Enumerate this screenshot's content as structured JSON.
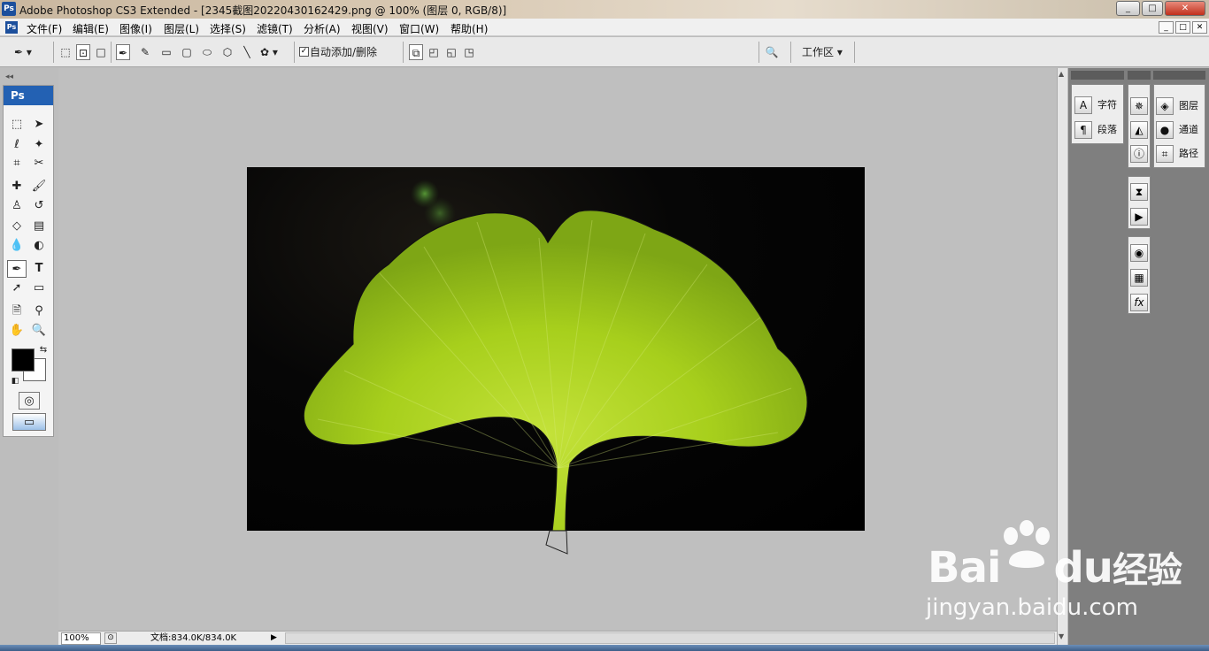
{
  "app": {
    "title": "Adobe Photoshop CS3 Extended - [2345截图20220430162429.png @ 100% (图层 0, RGB/8)]",
    "icon_label": "Ps"
  },
  "window_buttons": [
    "_",
    "□",
    "✕"
  ],
  "menu": {
    "items": [
      "文件(F)",
      "编辑(E)",
      "图像(I)",
      "图层(L)",
      "选择(S)",
      "滤镜(T)",
      "分析(A)",
      "视图(V)",
      "窗口(W)",
      "帮助(H)"
    ]
  },
  "options": {
    "auto_add_delete_label": "自动添加/删除",
    "auto_add_delete_checked": true,
    "workspace_label": "工作区"
  },
  "toolbox": {
    "header": "Ps",
    "tools": [
      "rect-marquee",
      "move",
      "lasso",
      "magic-wand",
      "crop",
      "slice",
      "healing",
      "brush",
      "stamp",
      "history-brush",
      "eraser",
      "gradient",
      "blur",
      "dodge",
      "pen",
      "type",
      "path-select",
      "shape",
      "notes",
      "eyedropper",
      "hand",
      "zoom"
    ]
  },
  "status": {
    "zoom": "100%",
    "doc_size": "文档:834.0K/834.0K"
  },
  "panels": {
    "col1": [
      {
        "icon": "A",
        "label": "字符"
      },
      {
        "icon": "¶",
        "label": "段落"
      }
    ],
    "col3": [
      {
        "icon": "◈",
        "label": "图层"
      },
      {
        "icon": "●",
        "label": "通道"
      },
      {
        "icon": "⌗",
        "label": "路径"
      }
    ]
  },
  "watermark": {
    "brand": "Bai",
    "brand2": "du",
    "suffix": "经验",
    "url": "jingyan.baidu.com"
  },
  "colors": {
    "accent": "#2361b3",
    "leaf": "#a7cf1c",
    "leaf_dark": "#6f9612",
    "canvas_bg": "#bfbfbf"
  }
}
